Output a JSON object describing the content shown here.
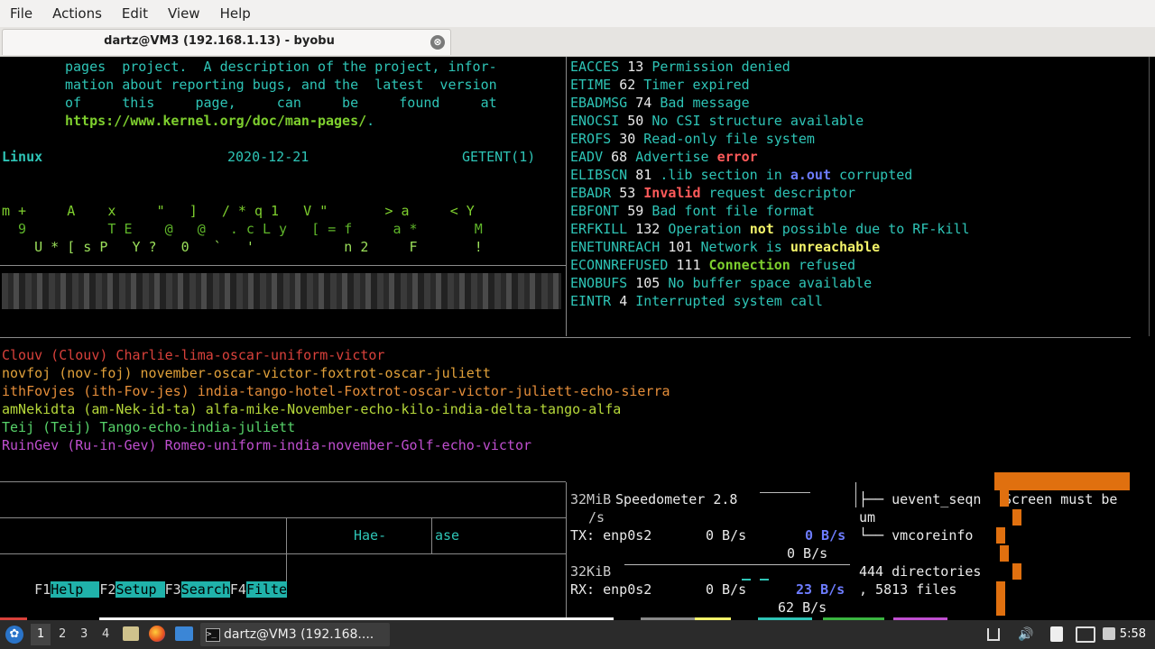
{
  "menu": [
    "File",
    "Actions",
    "Edit",
    "View",
    "Help"
  ],
  "tab": {
    "title": "dartz@VM3 (192.168.1.13) - byobu",
    "close": "⊗"
  },
  "man": {
    "l1": "pages  project.  A description of the project, infor-",
    "l2": "mation about reporting bugs, and the  latest  version",
    "l3": "of     this     page,     can     be     found     at",
    "url": "https://www.kernel.org/doc/man-pages/",
    "url_tail": ".",
    "footer_left": "Linux",
    "footer_mid": "2020-12-21",
    "footer_right": "GETENT(1)"
  },
  "matrix": {
    "r1": "m +     A    x     \"   ]   / * q 1   V \"       > a     < Y",
    "r2": "  9          T E    @   @   . c L y   [ = f     a *       M",
    "r3": "    U * [ s P   Y ?   0   `   '           n 2     F       !"
  },
  "errnos": [
    {
      "name": "EACCES",
      "num": "13",
      "desc": "Permission denied"
    },
    {
      "name": "ETIME",
      "num": "62",
      "desc": "Timer expired"
    },
    {
      "name": "EBADMSG",
      "num": "74",
      "desc": "Bad message"
    },
    {
      "name": "ENOCSI",
      "num": "50",
      "desc": "No CSI structure available"
    },
    {
      "name": "EROFS",
      "num": "30",
      "desc": "Read-only file system"
    },
    {
      "name": "EADV",
      "num": "68",
      "desc_a": "Advertise ",
      "desc_b": "error"
    },
    {
      "name": "ELIBSCN",
      "num": "81",
      "desc_a": ".lib section in ",
      "desc_b": "a.out",
      "desc_c": " corrupted"
    },
    {
      "name": "EBADR",
      "num": "53",
      "desc_a": "Invalid",
      "desc_b": " request descriptor"
    },
    {
      "name": "EBFONT",
      "num": "59",
      "desc": "Bad font file format"
    },
    {
      "name": "ERFKILL",
      "num": "132",
      "desc_a": "Operation ",
      "desc_b": "not",
      "desc_c": " possible due to RF-kill"
    },
    {
      "name": "ENETUNREACH",
      "num": "101",
      "desc_a": "Network is ",
      "desc_b": "unreachable"
    },
    {
      "name": "ECONNREFUSED",
      "num": "111",
      "desc_a": "Connection",
      "desc_b": " refused"
    },
    {
      "name": "ENOBUFS",
      "num": "105",
      "desc": "No buffer space available"
    },
    {
      "name": "EINTR",
      "num": "4",
      "desc": "Interrupted system call"
    }
  ],
  "phonetic": [
    {
      "text": "Clouv (Clouv) Charlie-lima-oscar-uniform-victor",
      "color": "#d9413b"
    },
    {
      "text": "novfoj (nov-foj) november-oscar-victor-foxtrot-oscar-juliett",
      "color": "#e1a13a"
    },
    {
      "text": "ithFovjes (ith-Fov-jes) india-tango-hotel-Foxtrot-oscar-victor-juliett-echo-sierra",
      "color": "#e58e3a"
    },
    {
      "text": "amNekidta (am-Nek-id-ta) alfa-mike-November-echo-kilo-india-delta-tango-alfa",
      "color": "#b6d83a"
    },
    {
      "text": "Teij (Teij) Tango-echo-india-juliett",
      "color": "#57d36a"
    },
    {
      "text": "RuinGev (Ru-in-Gev) Romeo-uniform-india-november-Golf-echo-victor",
      "color": "#c04fd0"
    }
  ],
  "htop": {
    "col1": "Hae-",
    "col2": "ase",
    "fkeys": [
      {
        "key": "F1",
        "label": "Help  "
      },
      {
        "key": "F2",
        "label": "Setup "
      },
      {
        "key": "F3",
        "label": "Search"
      },
      {
        "key": "F4",
        "label": "Filte"
      }
    ]
  },
  "speed": {
    "tx_scale": "32MiB",
    "tx_unit": "/s",
    "title": "Speedometer 2.8",
    "tx_label": "TX: enp0s2",
    "tx_cur": "0 B/s",
    "tx_peak": "0 B/s",
    "tx_avg": "0 B/s",
    "rx_scale": "32KiB",
    "rx_label": "RX: enp0s2",
    "rx_cur": "0 B/s",
    "rx_peak": "23 B/s",
    "rx_avg": "62 B/s"
  },
  "tree": {
    "l1": "├── uevent_seqn",
    "l1b": "um",
    "l2": "└── vmcoreinfo",
    "summary1": "444 directories",
    "summary2": ", 5813 files",
    "screen_msg": "Screen must be"
  },
  "taskbar": {
    "workspaces": [
      "1",
      "2",
      "3",
      "4"
    ],
    "task": "dartz@VM3 (192.168....",
    "clock": "5:58"
  },
  "colors": {
    "accent_teal": "#20b2aa",
    "orange": "#e0700f",
    "menubar": "#f2f1f0"
  }
}
